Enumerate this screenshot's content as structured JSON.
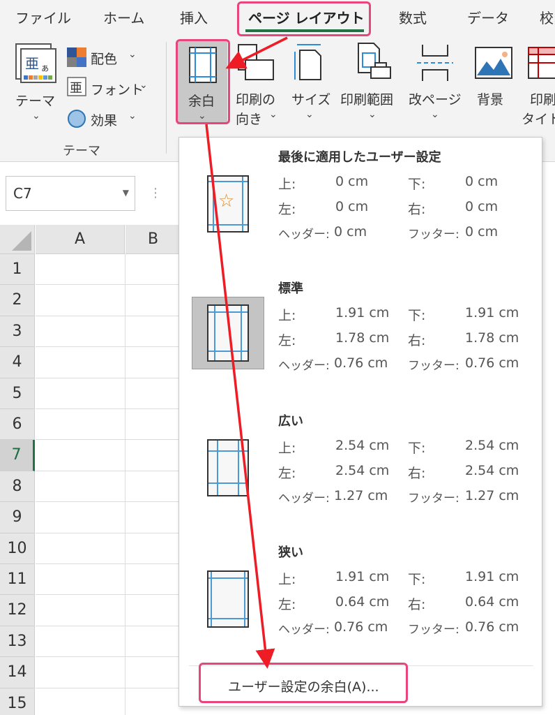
{
  "tabs": [
    {
      "label": "ファイル",
      "active": false
    },
    {
      "label": "ホーム",
      "active": false
    },
    {
      "label": "挿入",
      "active": false
    },
    {
      "label": "ページ レイアウト",
      "active": true
    },
    {
      "label": "数式",
      "active": false
    },
    {
      "label": "データ",
      "active": false
    },
    {
      "label": "校",
      "active": false
    }
  ],
  "ribbon": {
    "theme_group": {
      "theme_label": "テーマ",
      "colors_label": "配色",
      "fonts_label": "フォント",
      "effects_label": "効果",
      "group_label": "テーマ"
    },
    "page_setup": {
      "margins_label": "余白",
      "orientation_label_1": "印刷の",
      "orientation_label_2": "向き",
      "size_label": "サイズ",
      "print_area_label": "印刷範囲",
      "breaks_label": "改ページ",
      "background_label": "背景",
      "print_titles_label_1": "印刷",
      "print_titles_label_2": "タイト"
    },
    "accent_color": "#217346",
    "highlight_color": "#e8457e",
    "arrow_color": "#ee1c25"
  },
  "namebox": {
    "value": "C7"
  },
  "grid": {
    "columns": [
      "A",
      "B"
    ],
    "rows": [
      "1",
      "2",
      "3",
      "4",
      "5",
      "6",
      "7",
      "8",
      "9",
      "10",
      "11",
      "12",
      "13",
      "14",
      "15"
    ],
    "selected_row": "7"
  },
  "margins_menu": {
    "options": [
      {
        "title": "最後に適用したユーザー設定",
        "top_label": "上:",
        "top": "0 cm",
        "bottom_label": "下:",
        "bottom": "0 cm",
        "left_label": "左:",
        "left": "0 cm",
        "right_label": "右:",
        "right": "0 cm",
        "header_label": "ヘッダー:",
        "header": "0 cm",
        "footer_label": "フッター:",
        "footer": "0 cm",
        "icon": "star-icon"
      },
      {
        "title": "標準",
        "top_label": "上:",
        "top": "1.91 cm",
        "bottom_label": "下:",
        "bottom": "1.91 cm",
        "left_label": "左:",
        "left": "1.78 cm",
        "right_label": "右:",
        "right": "1.78 cm",
        "header_label": "ヘッダー:",
        "header": "0.76 cm",
        "footer_label": "フッター:",
        "footer": "0.76 cm",
        "selected": true
      },
      {
        "title": "広い",
        "top_label": "上:",
        "top": "2.54 cm",
        "bottom_label": "下:",
        "bottom": "2.54 cm",
        "left_label": "左:",
        "left": "2.54 cm",
        "right_label": "右:",
        "right": "2.54 cm",
        "header_label": "ヘッダー:",
        "header": "1.27 cm",
        "footer_label": "フッター:",
        "footer": "1.27 cm"
      },
      {
        "title": "狭い",
        "top_label": "上:",
        "top": "1.91 cm",
        "bottom_label": "下:",
        "bottom": "1.91 cm",
        "left_label": "左:",
        "left": "0.64 cm",
        "right_label": "右:",
        "right": "0.64 cm",
        "header_label": "ヘッダー:",
        "header": "0.76 cm",
        "footer_label": "フッター:",
        "footer": "0.76 cm"
      }
    ],
    "custom_label": "ユーザー設定の余白(A)..."
  }
}
